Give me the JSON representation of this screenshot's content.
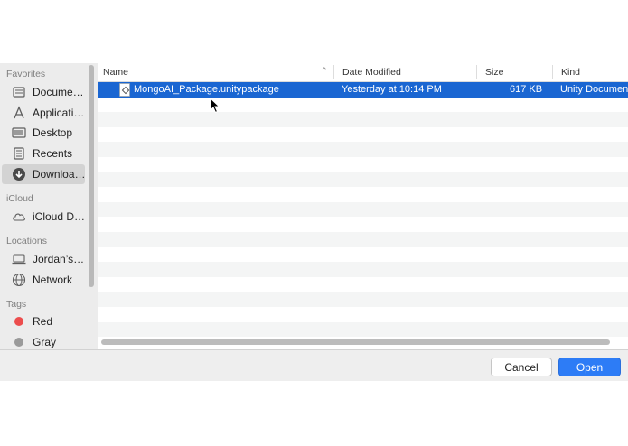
{
  "sidebar": {
    "sections": {
      "favorites": "Favorites",
      "icloud": "iCloud",
      "locations": "Locations",
      "tags": "Tags"
    },
    "favorites": [
      {
        "label": "Docume…",
        "icon": "documents-icon"
      },
      {
        "label": "Applicati…",
        "icon": "applications-icon"
      },
      {
        "label": "Desktop",
        "icon": "desktop-icon"
      },
      {
        "label": "Recents",
        "icon": "recents-icon"
      },
      {
        "label": "Downloa…",
        "icon": "downloads-icon",
        "selected": true
      }
    ],
    "icloud": [
      {
        "label": "iCloud D…",
        "icon": "cloud-icon"
      }
    ],
    "locations": [
      {
        "label": "Jordan’s…",
        "icon": "laptop-icon"
      },
      {
        "label": "Network",
        "icon": "network-icon"
      }
    ],
    "tags": [
      {
        "label": "Red",
        "color": "#ec4d4d"
      },
      {
        "label": "Gray",
        "color": "#9a9a9a"
      }
    ]
  },
  "filelist": {
    "columns": [
      "Name",
      "Date Modified",
      "Size",
      "Kind"
    ],
    "rows": [
      {
        "name": "MongoAI_Package.unitypackage",
        "date": "Yesterday at 10:14 PM",
        "size": "617 KB",
        "kind": "Unity Documen",
        "selected": true
      }
    ]
  },
  "footer": {
    "cancel_label": "Cancel",
    "open_label": "Open"
  },
  "colors": {
    "selection": "#1a66d2",
    "open_button": "#2d7cf6"
  }
}
